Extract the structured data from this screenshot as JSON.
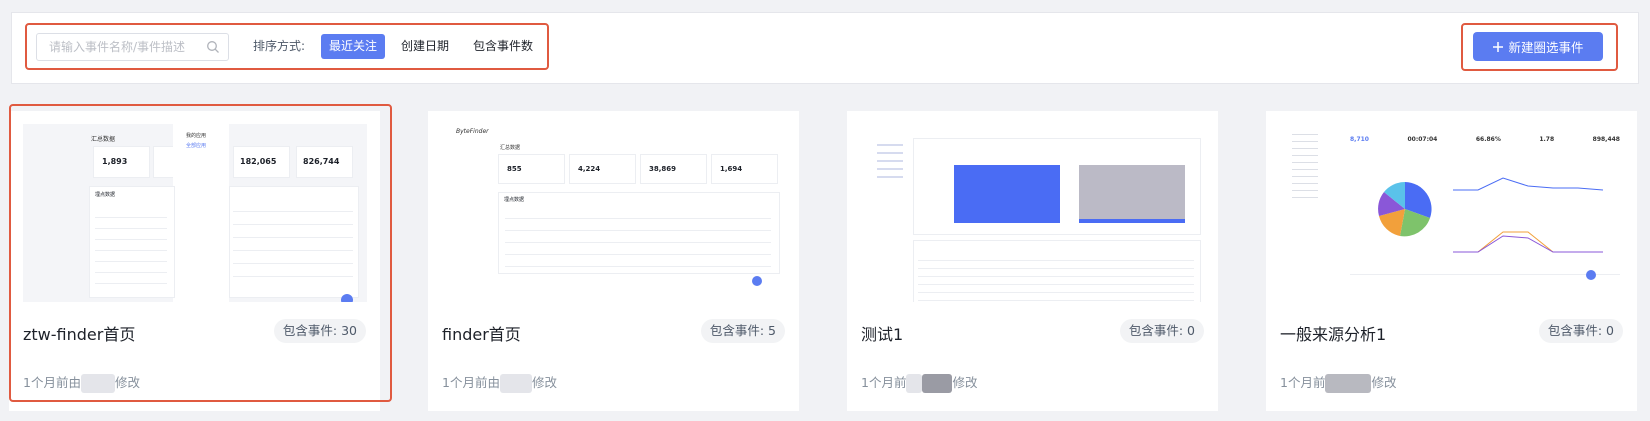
{
  "toolbar": {
    "search_placeholder": "请输入事件名称/事件描述",
    "sort_label": "排序方式:",
    "sort_options": [
      "最近关注",
      "创建日期",
      "包含事件数"
    ],
    "active_sort": "最近关注",
    "new_button_label": "新建圈选事件"
  },
  "cards": [
    {
      "title": "ztw-finder首页",
      "badge": "包含事件: 30",
      "meta_prefix": "1个月前由",
      "meta_suffix": "修改",
      "thumb": {
        "heading": "汇总数据",
        "sidebar_label": "我的应用",
        "sidebar_link": "全部应用",
        "stats": [
          "1,893",
          "182,065",
          "826,744"
        ],
        "table_title": "埋点数据"
      }
    },
    {
      "title": "finder首页",
      "badge": "包含事件: 5",
      "meta_prefix": "1个月前由",
      "meta_suffix": "修改",
      "thumb": {
        "brand": "ByteFinder",
        "heading": "汇总数据",
        "stats": [
          "855",
          "4,224",
          "38,869",
          "1,694"
        ],
        "table_title": "埋点数据"
      }
    },
    {
      "title": "测试1",
      "badge": "包含事件: 0",
      "meta_prefix": "1个月前",
      "meta_suffix": "修改",
      "thumb": {
        "heading": ""
      }
    },
    {
      "title": "一般来源分析1",
      "badge": "包含事件: 0",
      "meta_prefix": "1个月前",
      "meta_suffix": "修改",
      "thumb": {
        "stats": [
          "8,710",
          "00:07:04",
          "66.86%",
          "1.78",
          "898,448"
        ]
      }
    }
  ],
  "colors": {
    "accent": "#5b7cf1",
    "highlight": "#e05a40",
    "bar_blue": "#4a6cf4",
    "bar_gray": "#bbbac6"
  }
}
